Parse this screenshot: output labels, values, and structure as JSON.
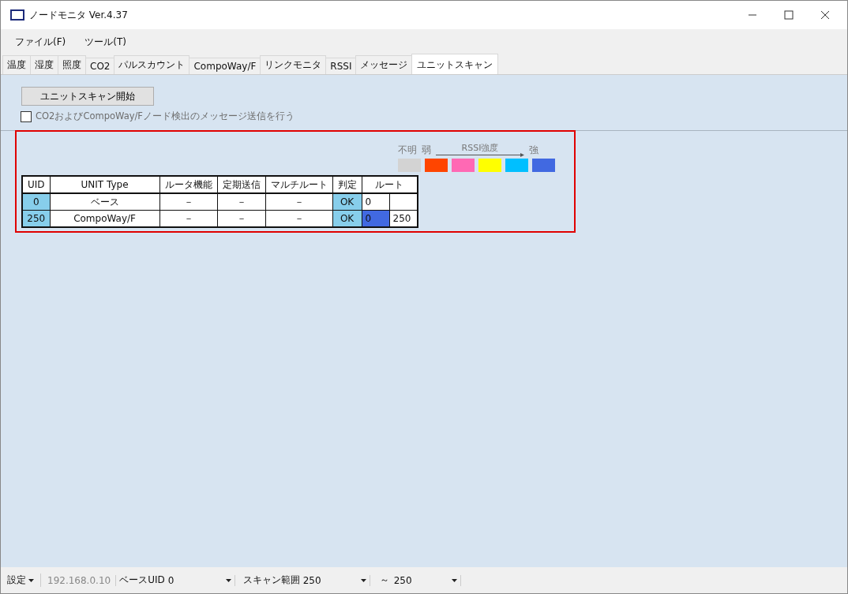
{
  "window": {
    "title": "ノードモニタ  Ver.4.37"
  },
  "menu": [
    "ファイル(F)",
    "ツール(T)"
  ],
  "tabs": [
    {
      "label": "温度",
      "selected": false
    },
    {
      "label": "湿度",
      "selected": false
    },
    {
      "label": "照度",
      "selected": false
    },
    {
      "label": "CO2",
      "selected": false
    },
    {
      "label": "パルスカウント",
      "selected": false
    },
    {
      "label": "CompoWay/F",
      "selected": false
    },
    {
      "label": "リンクモニタ",
      "selected": false
    },
    {
      "label": "RSSI",
      "selected": false
    },
    {
      "label": "メッセージ",
      "selected": false
    },
    {
      "label": "ユニットスキャン",
      "selected": true
    }
  ],
  "scan_button": "ユニットスキャン開始",
  "option": {
    "label": "CO2およびCompoWay/Fノード検出のメッセージ送信を行う",
    "checked": false,
    "disabled": true
  },
  "legend": {
    "unknown": "不明",
    "weak": "弱",
    "title": "RSSI強度",
    "strong": "強",
    "swatches": [
      {
        "color": "#d3d3d3"
      },
      {
        "color": "#ff4500"
      },
      {
        "color": "#ff69b4"
      },
      {
        "color": "#ffff00"
      },
      {
        "color": "#00bfff"
      },
      {
        "color": "#4169e1"
      }
    ]
  },
  "table": {
    "columns": [
      "UID",
      "UNIT Type",
      "ルータ機能",
      "定期送信",
      "マルチルート",
      "判定",
      "ルート"
    ],
    "rows": [
      {
        "uid": "0",
        "type": "ベース",
        "router": "－",
        "periodic": "－",
        "multi": "－",
        "judge": "OK",
        "route": [
          {
            "text": "0",
            "color": "#ffffff"
          }
        ]
      },
      {
        "uid": "250",
        "type": "CompoWay/F",
        "router": "－",
        "periodic": "－",
        "multi": "－",
        "judge": "OK",
        "route": [
          {
            "text": "0",
            "color": "#4169e1"
          },
          {
            "text": "250",
            "color": "#ffffff"
          }
        ]
      }
    ]
  },
  "status_bar": [
    {
      "kind": "dropdown",
      "text": "設定"
    },
    {
      "kind": "muted",
      "text": "192.168.0.10"
    },
    {
      "kind": "label",
      "text": "ベースUID"
    },
    {
      "kind": "combo",
      "text": "0"
    },
    {
      "kind": "label",
      "text": "スキャン範囲"
    },
    {
      "kind": "combo",
      "text": "250"
    },
    {
      "kind": "plain",
      "text": "～"
    },
    {
      "kind": "combo",
      "text": "250"
    }
  ]
}
